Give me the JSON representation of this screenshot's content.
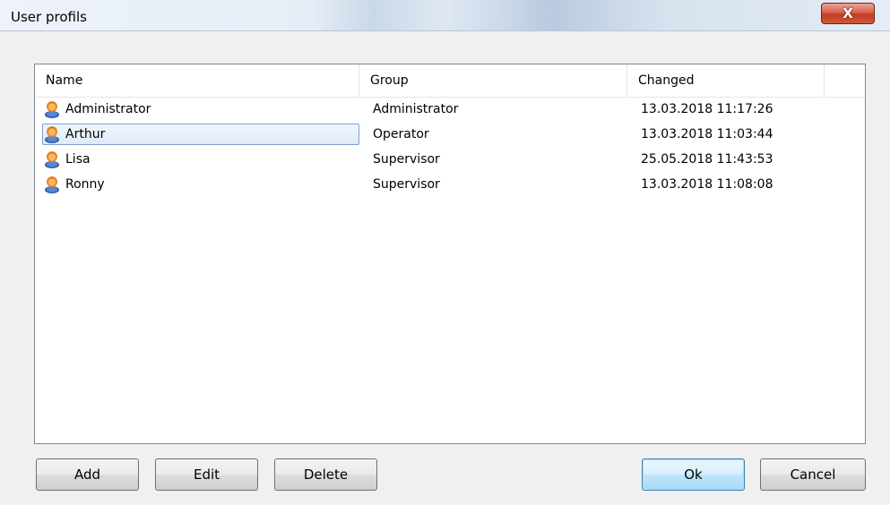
{
  "window": {
    "title": "User profils",
    "close_label": "X"
  },
  "table": {
    "columns": [
      "Name",
      "Group",
      "Changed"
    ],
    "rows": [
      {
        "name": "Administrator",
        "group": "Administrator",
        "changed": "13.03.2018 11:17:26",
        "selected": false
      },
      {
        "name": "Arthur",
        "group": "Operator",
        "changed": "13.03.2018 11:03:44",
        "selected": true
      },
      {
        "name": "Lisa",
        "group": "Supervisor",
        "changed": "25.05.2018 11:43:53",
        "selected": false
      },
      {
        "name": "Ronny",
        "group": "Supervisor",
        "changed": "13.03.2018 11:08:08",
        "selected": false
      }
    ],
    "row_icon": "user-icon"
  },
  "buttons": {
    "add": "Add",
    "edit": "Edit",
    "delete": "Delete",
    "ok": "Ok",
    "cancel": "Cancel"
  },
  "colors": {
    "close_button": "#c94a30",
    "selection_border": "#7da2ce",
    "default_button_border": "#3c7fb1"
  }
}
